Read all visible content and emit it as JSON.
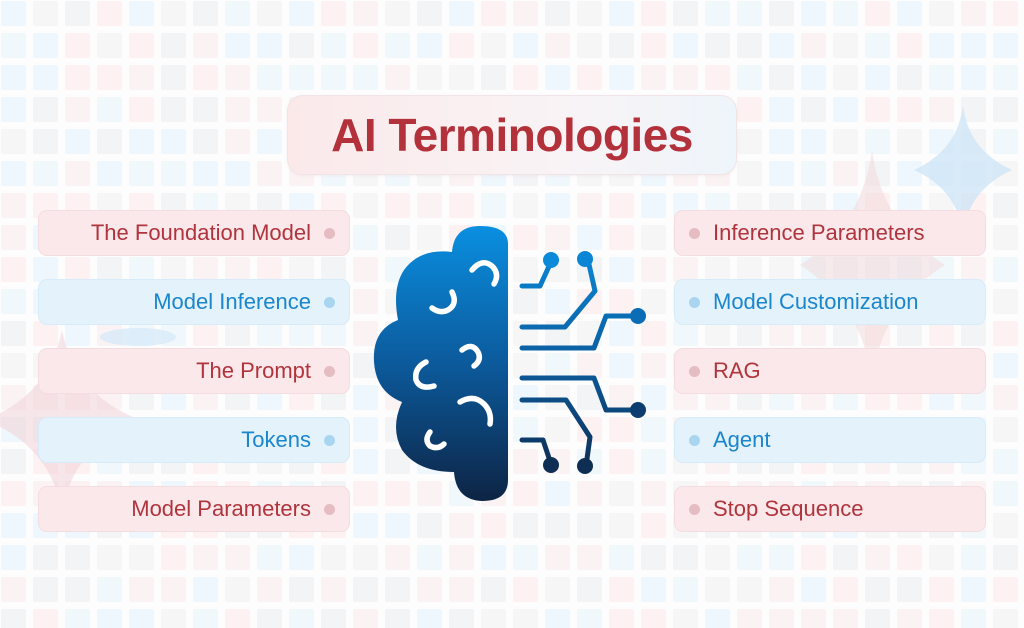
{
  "title": "AI Terminologies",
  "colors": {
    "title_text": "#b3313b",
    "red_pill_bg": "#fae8ea",
    "red_pill_text": "#b0343d",
    "blue_pill_bg": "#e4f2fc",
    "blue_pill_text": "#1a86cc",
    "brain_gradient_top": "#0a8fe0",
    "brain_gradient_bottom": "#0d2444"
  },
  "left_terms": [
    {
      "label": "The Foundation Model",
      "theme": "red"
    },
    {
      "label": "Model Inference",
      "theme": "blue"
    },
    {
      "label": "The Prompt",
      "theme": "red"
    },
    {
      "label": "Tokens",
      "theme": "blue"
    },
    {
      "label": "Model Parameters",
      "theme": "red"
    }
  ],
  "right_terms": [
    {
      "label": "Inference Parameters",
      "theme": "red"
    },
    {
      "label": "Model Customization",
      "theme": "blue"
    },
    {
      "label": "RAG",
      "theme": "red"
    },
    {
      "label": "Agent",
      "theme": "blue"
    },
    {
      "label": "Stop Sequence",
      "theme": "red"
    }
  ],
  "icons": {
    "center": "brain-circuit-icon",
    "bullet": "dot-icon",
    "decoration": "sparkle-star-icon"
  }
}
